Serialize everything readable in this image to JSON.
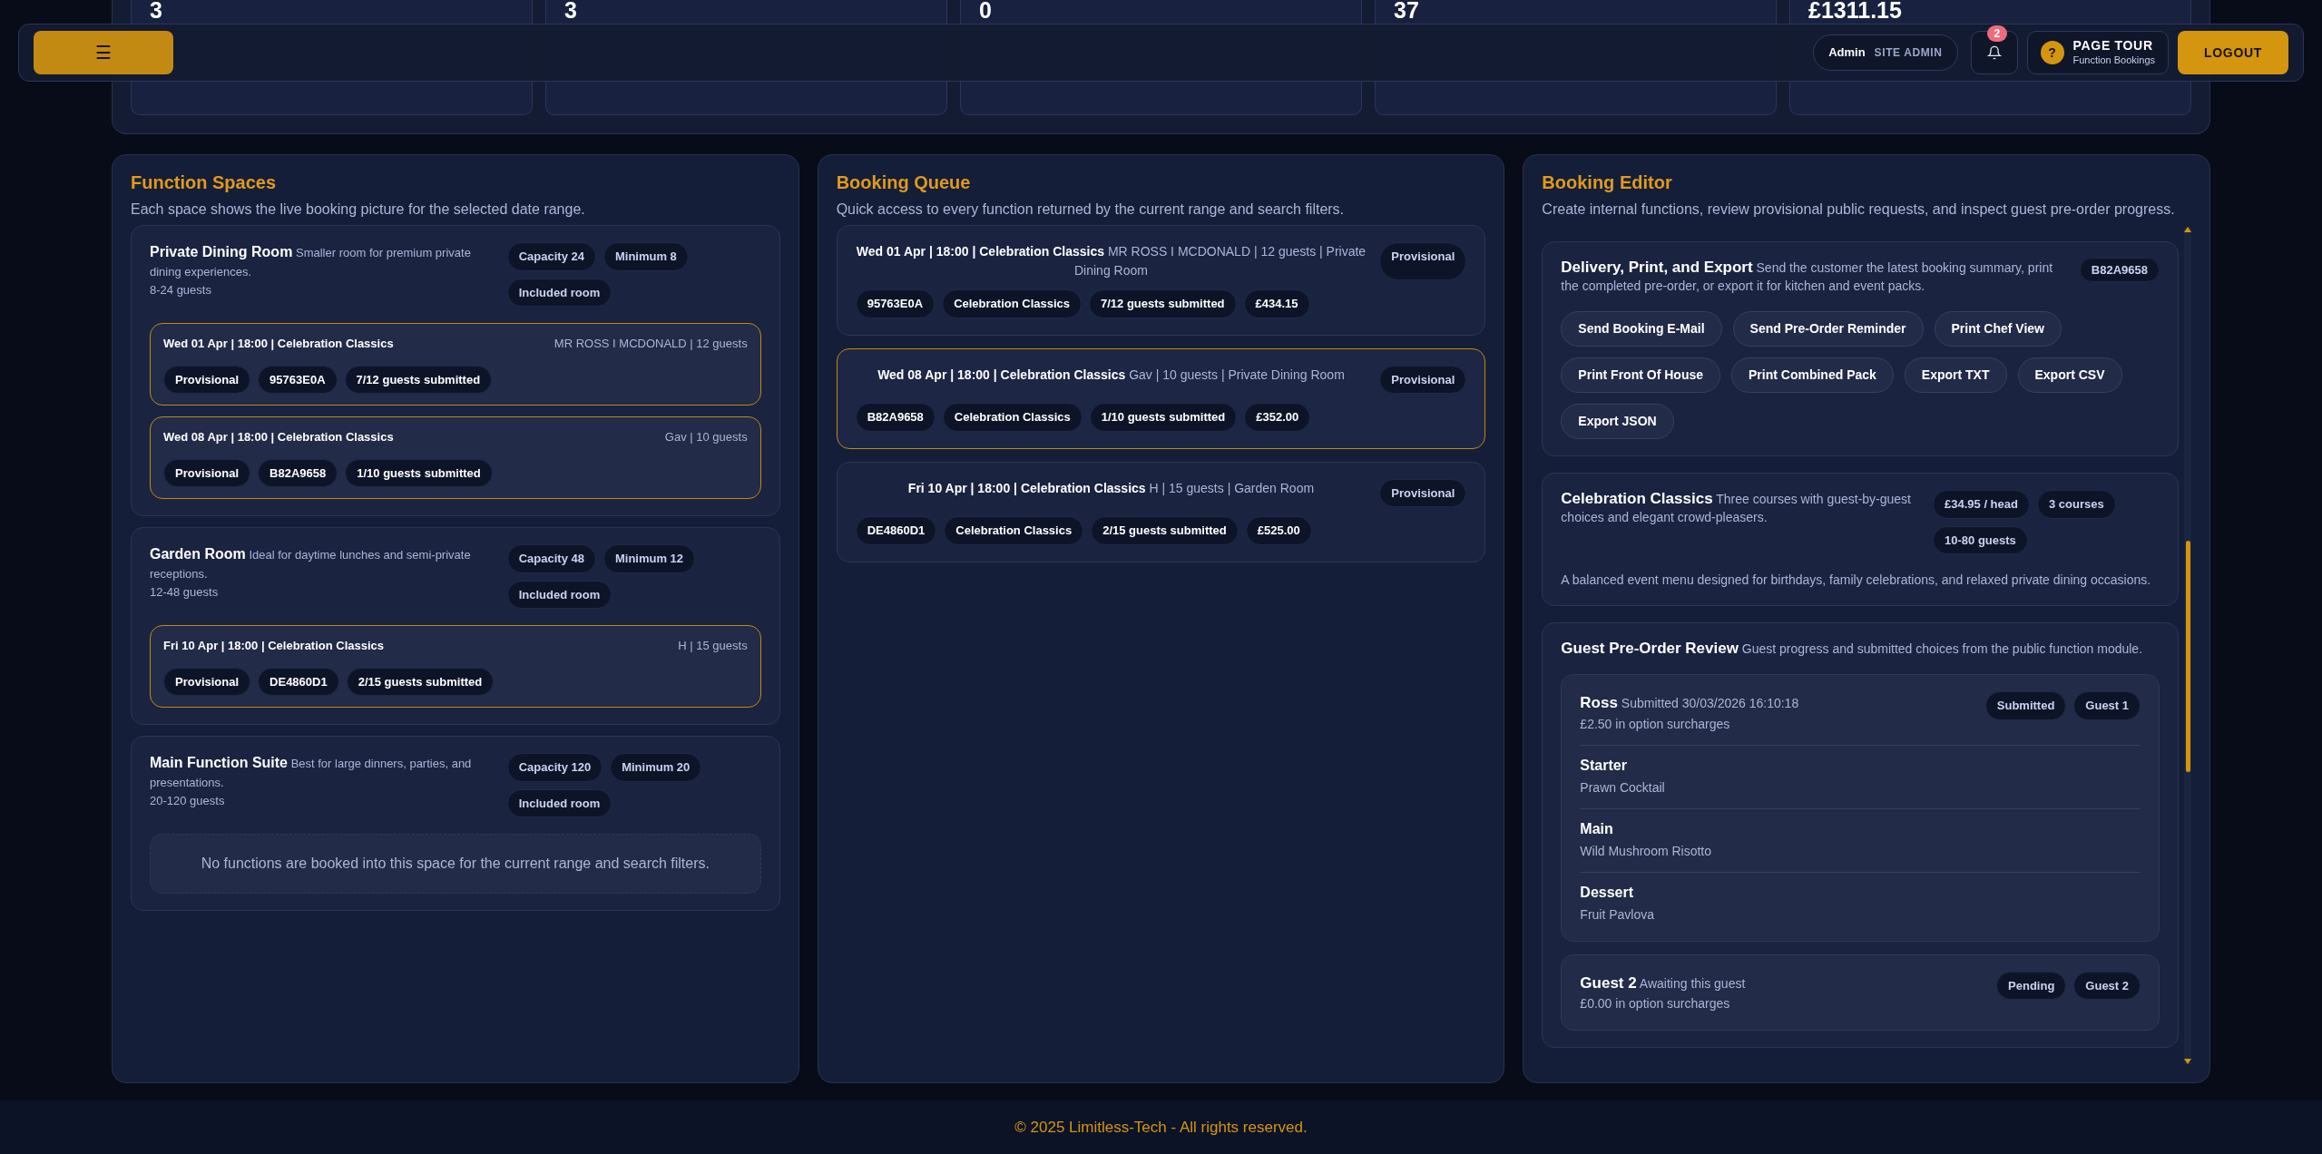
{
  "header": {
    "menu_icon": "☰",
    "user": "Admin",
    "role": "SITE ADMIN",
    "notifications": "2",
    "tour_icon": "?",
    "tour_title": "PAGE TOUR",
    "tour_subtitle": "Function Bookings",
    "logout": "LOGOUT"
  },
  "stats": [
    {
      "value": "3"
    },
    {
      "value": "3"
    },
    {
      "value": "0"
    },
    {
      "value": "37"
    },
    {
      "value": "£1311.15"
    }
  ],
  "function_spaces": {
    "title": "Function Spaces",
    "subtitle": "Each space shows the live booking picture for the selected date range.",
    "spaces": [
      {
        "name": "Private Dining Room",
        "description": "Smaller room for premium private dining experiences.",
        "guests": "8-24 guests",
        "badges": [
          "Capacity 24",
          "Minimum 8",
          "Included room"
        ],
        "bookings": [
          {
            "title": "Wed 01 Apr | 18:00 | Celebration Classics",
            "customer": "MR ROSS I MCDONALD | 12 guests",
            "badges": [
              "Provisional",
              "95763E0A",
              "7/12 guests submitted"
            ]
          },
          {
            "title": "Wed 08 Apr | 18:00 | Celebration Classics",
            "customer": "Gav | 10 guests",
            "badges": [
              "Provisional",
              "B82A9658",
              "1/10 guests submitted"
            ]
          }
        ]
      },
      {
        "name": "Garden Room",
        "description": "Ideal for daytime lunches and semi-private receptions.",
        "guests": "12-48 guests",
        "badges": [
          "Capacity 48",
          "Minimum 12",
          "Included room"
        ],
        "bookings": [
          {
            "title": "Fri 10 Apr | 18:00 | Celebration Classics",
            "customer": "H | 15 guests",
            "badges": [
              "Provisional",
              "DE4860D1",
              "2/15 guests submitted"
            ]
          }
        ]
      },
      {
        "name": "Main Function Suite",
        "description": "Best for large dinners, parties, and presentations.",
        "guests": "20-120 guests",
        "badges": [
          "Capacity 120",
          "Minimum 20",
          "Included room"
        ],
        "empty": "No functions are booked into this space for the current range and search filters."
      }
    ]
  },
  "booking_queue": {
    "title": "Booking Queue",
    "subtitle": "Quick access to every function returned by the current range and search filters.",
    "items": [
      {
        "title": "Wed 01 Apr | 18:00 | Celebration Classics",
        "details": "MR ROSS I MCDONALD | 12 guests | Private Dining Room",
        "status": "Provisional",
        "badges": [
          "95763E0A",
          "Celebration Classics",
          "7/12 guests submitted",
          "£434.15"
        ],
        "selected": false
      },
      {
        "title": "Wed 08 Apr | 18:00 | Celebration Classics",
        "details": "Gav | 10 guests | Private Dining Room",
        "status": "Provisional",
        "badges": [
          "B82A9658",
          "Celebration Classics",
          "1/10 guests submitted",
          "£352.00"
        ],
        "selected": true
      },
      {
        "title": "Fri 10 Apr | 18:00 | Celebration Classics",
        "details": "H | 15 guests | Garden Room",
        "status": "Provisional",
        "badges": [
          "DE4860D1",
          "Celebration Classics",
          "2/15 guests submitted",
          "£525.00"
        ],
        "selected": false
      }
    ]
  },
  "booking_editor": {
    "title": "Booking Editor",
    "subtitle": "Create internal functions, review provisional public requests, and inspect guest pre-order progress.",
    "delivery": {
      "title": "Delivery, Print, and Export",
      "description": "Send the customer the latest booking summary, print the completed pre-order, or export it for kitchen and event packs.",
      "ref": "B82A9658",
      "actions": [
        "Send Booking E-Mail",
        "Send Pre-Order Reminder",
        "Print Chef View",
        "Print Front Of House",
        "Print Combined Pack",
        "Export TXT",
        "Export CSV",
        "Export JSON"
      ]
    },
    "menu": {
      "name": "Celebration Classics",
      "description": "Three courses with guest-by-guest choices and elegant crowd-pleasers.",
      "price": "£34.95 / head",
      "badges": [
        "3 courses",
        "10-80 guests"
      ],
      "summary": "A balanced event menu designed for birthdays, family celebrations, and relaxed private dining occasions."
    },
    "preorders": {
      "title": "Guest Pre-Order Review",
      "description": "Guest progress and submitted choices from the public function module.",
      "guests": [
        {
          "name": "Ross",
          "status_line": "Submitted 30/03/2026 16:10:18",
          "surcharge": "£2.50 in option surcharges",
          "badges": [
            "Submitted",
            "Guest 1"
          ],
          "courses": [
            {
              "course": "Starter",
              "choice": "Prawn Cocktail"
            },
            {
              "course": "Main",
              "choice": "Wild Mushroom Risotto"
            },
            {
              "course": "Dessert",
              "choice": "Fruit Pavlova"
            }
          ]
        },
        {
          "name": "Guest 2",
          "status_line": "Awaiting this guest",
          "surcharge": "£0.00 in option surcharges",
          "badges": [
            "Pending",
            "Guest 2"
          ]
        }
      ]
    }
  },
  "footer": "© 2025 Limitless-Tech - All rights reserved."
}
